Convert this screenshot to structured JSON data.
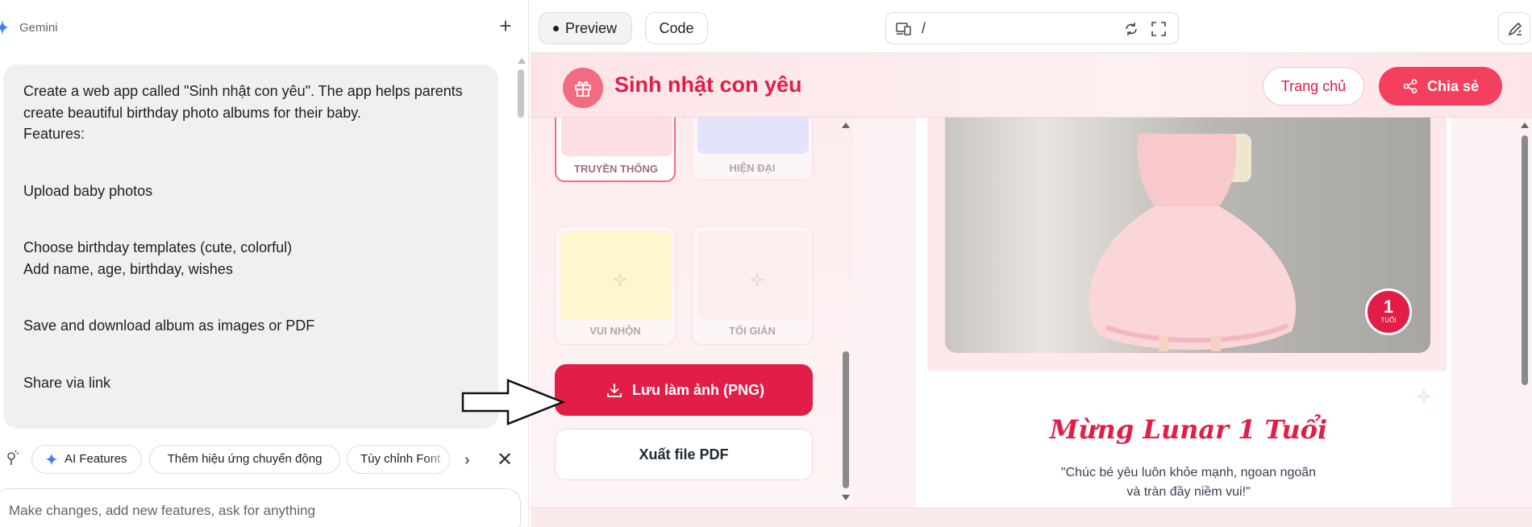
{
  "left_panel": {
    "title": "Gemini",
    "prompt": {
      "line1": "Create a web app called \"Sinh nhật con yêu\". The app helps parents create beautiful birthday photo albums for their baby.",
      "line2": "Features:",
      "line3": "Upload baby photos",
      "line4": "Choose birthday templates (cute, colorful)",
      "line5": "Add name, age, birthday, wishes",
      "line6": "Save and download album as images or PDF",
      "line7": "Share via link"
    },
    "chips": {
      "ai_features": "AI Features",
      "motion": "Thêm hiệu ứng chuyển động",
      "font": "Tùy chỉnh Font"
    },
    "input_placeholder": "Make changes, add new features, ask for anything"
  },
  "toolbar": {
    "preview_label": "Preview",
    "code_label": "Code",
    "url_path": "/"
  },
  "app": {
    "title": "Sinh nhật con yêu",
    "home_label": "Trang chủ",
    "share_label": "Chia sẻ",
    "templates": {
      "traditional": "TRUYỀN THỐNG",
      "modern": "HIỆN ĐẠI",
      "fun": "VUI NHỘN",
      "minimal": "TỐI GIẢN"
    },
    "save_png_label": "Lưu làm ảnh (PNG)",
    "export_pdf_label": "Xuất file PDF",
    "age_badge_number": "1",
    "age_badge_unit": "TUỔI",
    "greeting_title": "Mừng Lunar 1 Tuổi",
    "wish_line1": "\"Chúc bé yêu luôn khỏe mạnh, ngoan ngoãn",
    "wish_line2": "và tràn đầy niềm vui!\""
  },
  "colors": {
    "brand": "#e11d48",
    "accent": "#f43f5e",
    "soft_pink": "#fde4e7"
  },
  "icons": [
    "gemini-star-icon",
    "plus-icon",
    "mic-icon",
    "sparkle-icon",
    "chevron-right-icon",
    "close-icon",
    "device-icon",
    "refresh-icon",
    "fullscreen-icon",
    "edit-icon",
    "gift-icon",
    "share-icon",
    "download-icon"
  ]
}
